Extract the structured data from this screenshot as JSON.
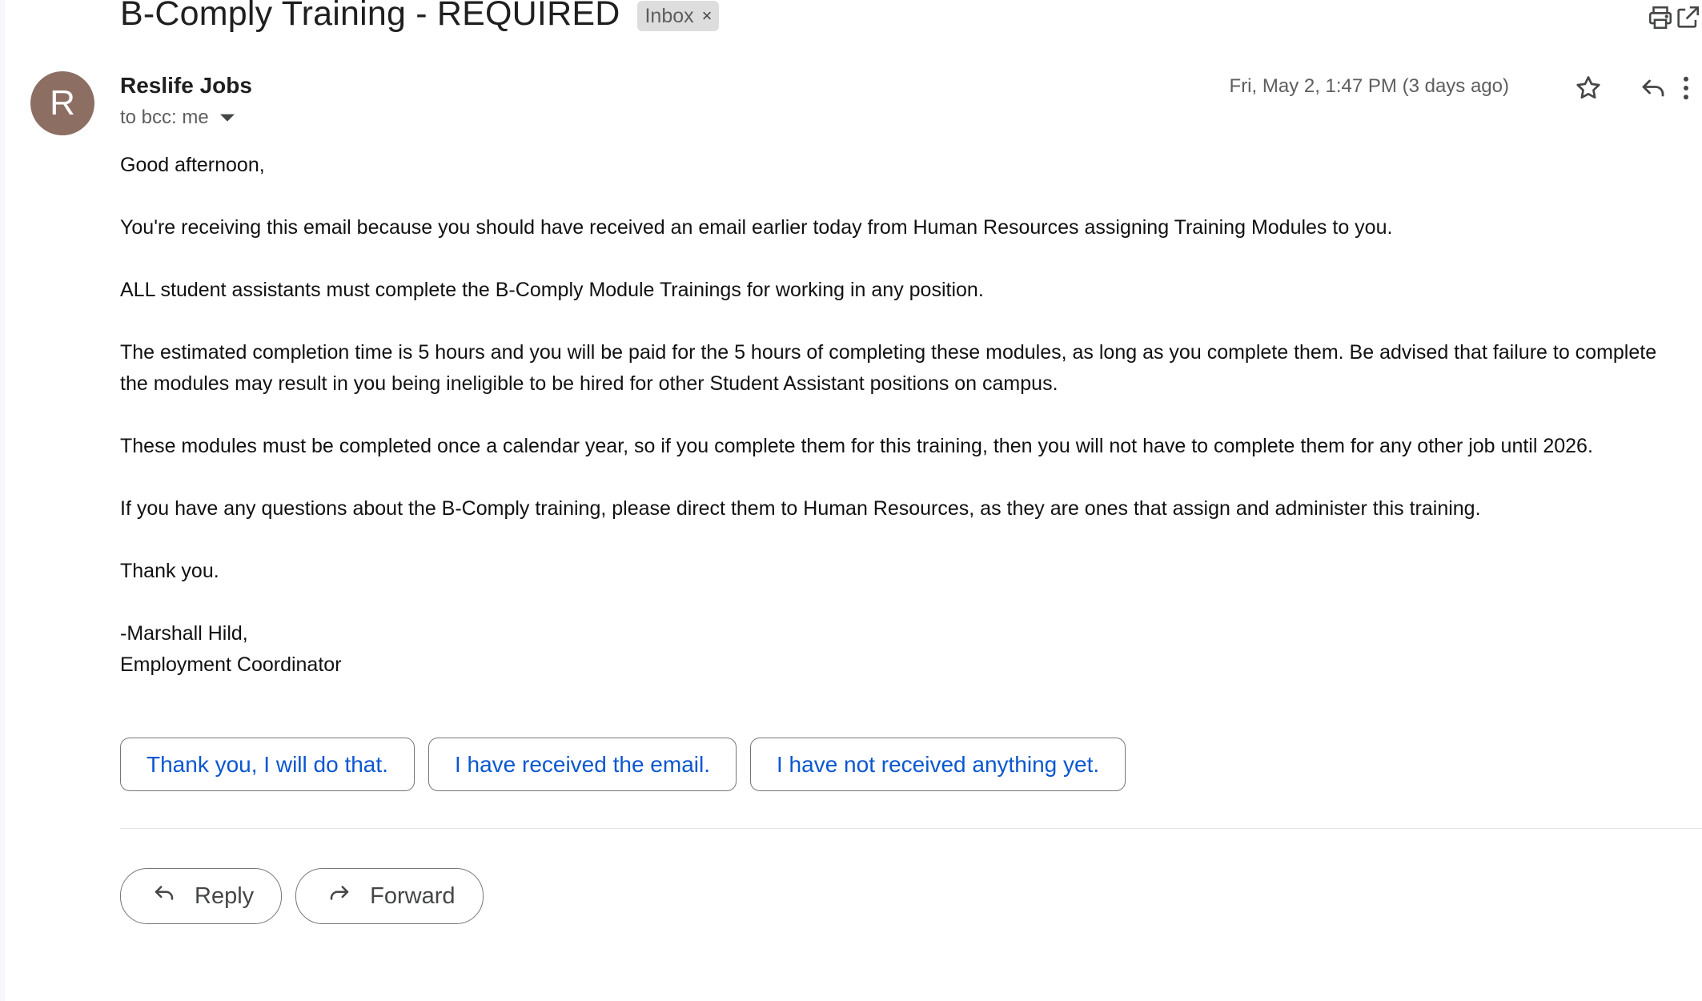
{
  "subject": "B-Comply Training - REQUIRED",
  "label": {
    "name": "Inbox",
    "remove": "×"
  },
  "sender": {
    "initial": "R",
    "name": "Reslife Jobs",
    "recipients": "to bcc: me"
  },
  "date": "Fri, May 2, 1:47 PM (3 days ago)",
  "body": {
    "greeting": "Good afternoon,",
    "p1": "You're receiving this email because you should have received an email earlier today from Human Resources assigning Training Modules to you.",
    "p2": "ALL student assistants must complete the B-Comply Module Trainings for working in any position.",
    "p3": "The estimated completion time is 5 hours and you will be paid for the 5 hours of completing these modules, as long as you complete them. Be advised that failure to complete the modules may result in you being ineligible to be hired for other Student Assistant positions on campus.",
    "p4": "These modules must be completed once a calendar year, so if you complete them for this training, then you will not have to complete them for any other job until 2026.",
    "p5": "If you have any questions about the B-Comply training, please direct them to Human Resources, as they are ones that assign and administer this training.",
    "thanks": "Thank you.",
    "sig_name": "-Marshall Hild,",
    "sig_title": "Employment Coordinator"
  },
  "smart_replies": [
    "Thank you, I will do that.",
    "I have received the email.",
    "I have not received anything yet."
  ],
  "actions": {
    "reply": "Reply",
    "forward": "Forward"
  },
  "colors": {
    "avatar": "#8d6e63",
    "link": "#0b57d0",
    "chip": "#dddddd"
  },
  "icons": [
    "print-icon",
    "open-in-new-window-icon",
    "star-icon",
    "reply-icon",
    "more-vert-icon",
    "dropdown-arrow-icon",
    "forward-icon"
  ]
}
